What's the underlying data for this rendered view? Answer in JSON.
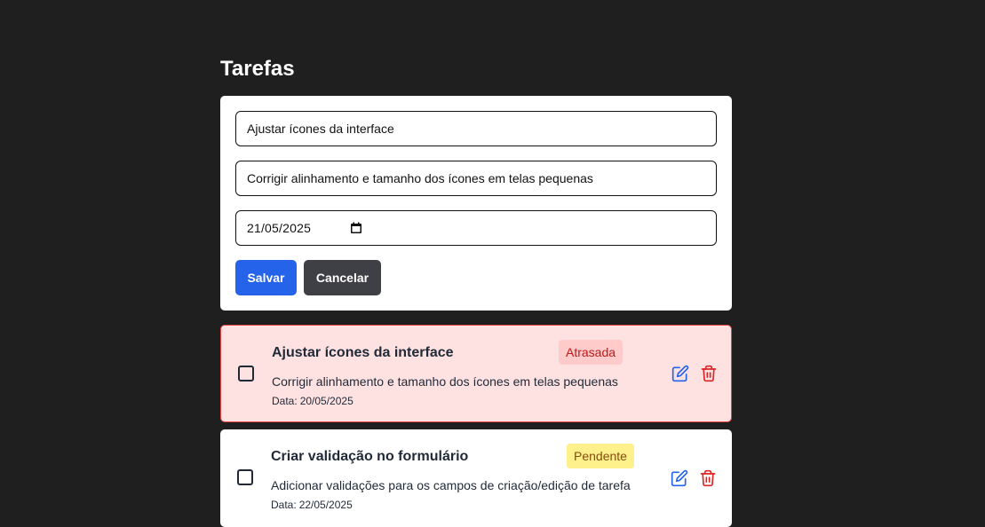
{
  "header": {
    "title": "Tarefas"
  },
  "form": {
    "title_value": "Ajustar ícones da interface",
    "description_value": "Corrigir alinhamento e tamanho dos ícones em telas pequenas",
    "date_value": "21/05/2025",
    "save_label": "Salvar",
    "cancel_label": "Cancelar"
  },
  "tasks": [
    {
      "title": "Ajustar ícones da interface",
      "status": "Atrasada",
      "description": "Corrigir alinhamento e tamanho dos ícones em telas pequenas",
      "date_label": "Data:",
      "date": "20/05/2025",
      "checked": false
    },
    {
      "title": "Criar validação no formulário",
      "status": "Pendente",
      "description": "Adicionar validações para os campos de criação/edição de tarefa",
      "date_label": "Data:",
      "date": "22/05/2025",
      "checked": false
    }
  ],
  "colors": {
    "background": "#1f1f1f",
    "primary": "#2563eb",
    "secondary": "#3f3f46",
    "late_bg": "#fee2e2",
    "late_border": "#ef4444",
    "pending_badge": "#fef08a",
    "edit_icon": "#2563eb",
    "delete_icon": "#dc2626"
  },
  "icons": {
    "edit": "edit-icon",
    "delete": "trash-icon",
    "calendar": "calendar-icon"
  }
}
